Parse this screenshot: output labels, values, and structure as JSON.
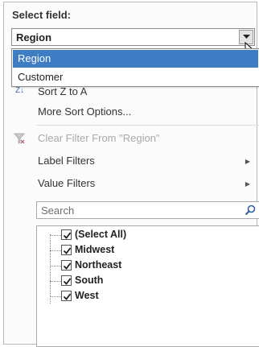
{
  "field_selector": {
    "label": "Select field:",
    "selected_value": "Region",
    "options": [
      {
        "label": "Region",
        "selected": true
      },
      {
        "label": "Customer",
        "selected": false
      }
    ]
  },
  "menu": {
    "sort_z_to_a": "Sort Z to A",
    "more_sort_options": "More Sort Options...",
    "clear_filter": "Clear Filter From \"Region\"",
    "label_filters": "Label Filters",
    "value_filters": "Value Filters"
  },
  "search": {
    "placeholder": "Search"
  },
  "checklist": [
    {
      "label": "(Select All)",
      "checked": true
    },
    {
      "label": "Midwest",
      "checked": true
    },
    {
      "label": "Northeast",
      "checked": true
    },
    {
      "label": "South",
      "checked": true
    },
    {
      "label": "West",
      "checked": true
    }
  ],
  "colors": {
    "selection": "#3e7cc3",
    "disabled_text": "#a9a9a9"
  }
}
